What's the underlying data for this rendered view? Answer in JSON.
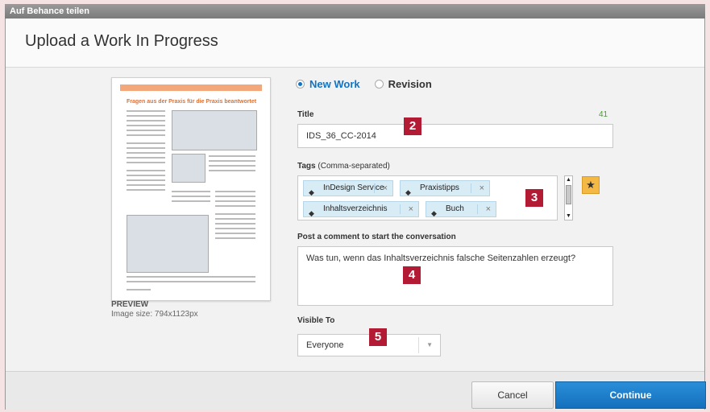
{
  "window": {
    "title": "Auf Behance teilen"
  },
  "dialog": {
    "heading": "Upload a Work In Progress"
  },
  "preview": {
    "title": "PREVIEW",
    "image_size": "Image size: 794x1123px",
    "thumb_heading": "Fragen aus der Praxis für die Praxis beantwortet"
  },
  "mode": {
    "options": [
      {
        "label": "New Work",
        "selected": true
      },
      {
        "label": "Revision",
        "selected": false
      }
    ]
  },
  "title_field": {
    "label": "Title",
    "value": "IDS_36_CC-2014",
    "counter": "41"
  },
  "tags_field": {
    "label": "Tags",
    "hint": "(Comma-separated)",
    "tags": [
      "InDesign Service",
      "Praxistipps",
      "Inhaltsverzeichnis",
      "Buch"
    ],
    "tag_icon": "tag-icon",
    "remove_glyph": "×"
  },
  "comment_field": {
    "label": "Post a comment to start the conversation",
    "value": "Was tun, wenn das Inhaltsverzeichnis falsche Seitenzahlen erzeugt?"
  },
  "visibility": {
    "label": "Visible To",
    "selected": "Everyone"
  },
  "badges": [
    "2",
    "3",
    "4",
    "5"
  ],
  "buttons": {
    "cancel": "Cancel",
    "continue": "Continue"
  },
  "colors": {
    "accent": "#1473c0",
    "badge": "#b31b34",
    "star": "#f4b844",
    "counter": "#4a9a34"
  }
}
